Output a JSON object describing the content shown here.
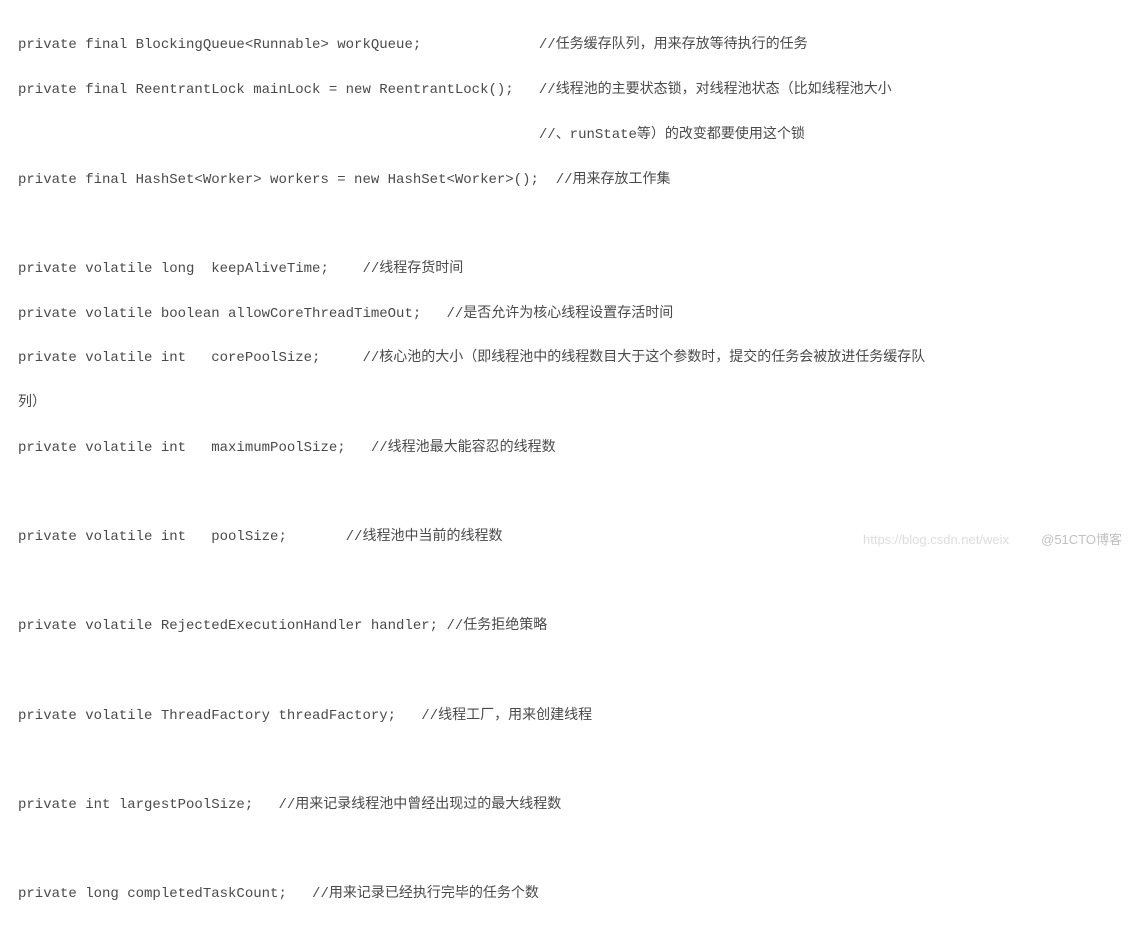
{
  "code_lines": [
    "private final BlockingQueue<Runnable> workQueue;              //任务缓存队列，用来存放等待执行的任务",
    "private final ReentrantLock mainLock = new ReentrantLock();   //线程池的主要状态锁，对线程池状态（比如线程池大小",
    "                                                              //、runState等）的改变都要使用这个锁",
    "private final HashSet<Worker> workers = new HashSet<Worker>();  //用来存放工作集",
    "",
    "private volatile long  keepAliveTime;    //线程存货时间   ",
    "private volatile boolean allowCoreThreadTimeOut;   //是否允许为核心线程设置存活时间",
    "private volatile int   corePoolSize;     //核心池的大小（即线程池中的线程数目大于这个参数时，提交的任务会被放进任务缓存队",
    "列）",
    "private volatile int   maximumPoolSize;   //线程池最大能容忍的线程数",
    "",
    "private volatile int   poolSize;       //线程池中当前的线程数",
    "",
    "private volatile RejectedExecutionHandler handler; //任务拒绝策略",
    "",
    "private volatile ThreadFactory threadFactory;   //线程工厂，用来创建线程",
    "",
    "private int largestPoolSize;   //用来记录线程池中曾经出现过的最大线程数",
    "",
    "private long completedTaskCount;   //用来记录已经执行完毕的任务个数"
  ],
  "watermark_left": "https://blog.csdn.net/weix",
  "watermark_right": "@51CTO博客"
}
